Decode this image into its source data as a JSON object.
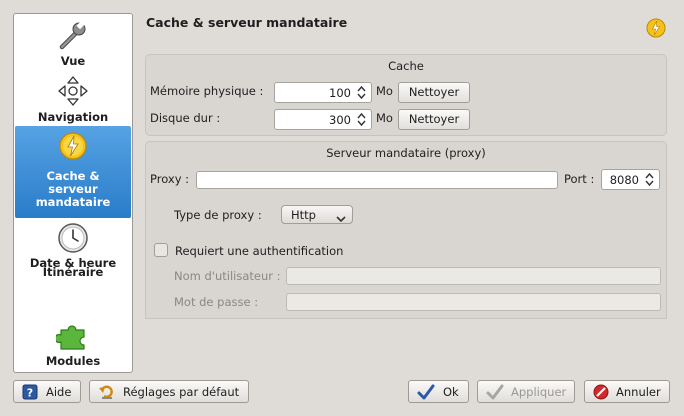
{
  "sidebar": {
    "items": [
      {
        "label": "Vue",
        "icon": "wrench-icon"
      },
      {
        "label": "Navigation",
        "icon": "navigation-arrows-icon"
      },
      {
        "label": "Cache & serveur mandataire",
        "icon": "lightning-icon",
        "selected": true
      },
      {
        "label": "Date & heure",
        "icon": "clock-icon"
      },
      {
        "label": "Itinéraire",
        "icon": ""
      },
      {
        "label": "Modules",
        "icon": "puzzle-icon"
      }
    ]
  },
  "page": {
    "title": "Cache & serveur mandataire",
    "header_icon": "lightning-icon"
  },
  "cache": {
    "title": "Cache",
    "memory_label": "Mémoire physique :",
    "memory_value": "100",
    "memory_unit": "Mo",
    "memory_clear": "Nettoyer",
    "disk_label": "Disque dur :",
    "disk_value": "300",
    "disk_unit": "Mo",
    "disk_clear": "Nettoyer"
  },
  "proxy": {
    "title": "Serveur mandataire (proxy)",
    "proxy_label": "Proxy :",
    "proxy_value": "",
    "port_label": "Port :",
    "port_value": "8080",
    "type_label": "Type de proxy :",
    "type_value": "Http",
    "auth_label": "Requiert une authentification",
    "auth_checked": false,
    "username_label": "Nom d'utilisateur :",
    "username_value": "",
    "password_label": "Mot de passe :",
    "password_value": ""
  },
  "buttons": {
    "help": "Aide",
    "defaults": "Réglages par défaut",
    "ok": "Ok",
    "apply": "Appliquer",
    "cancel": "Annuler"
  },
  "colors": {
    "selection": "#3b8fd6",
    "window_bg": "#dfdcd8",
    "icon_yellow": "#f6c21a"
  }
}
